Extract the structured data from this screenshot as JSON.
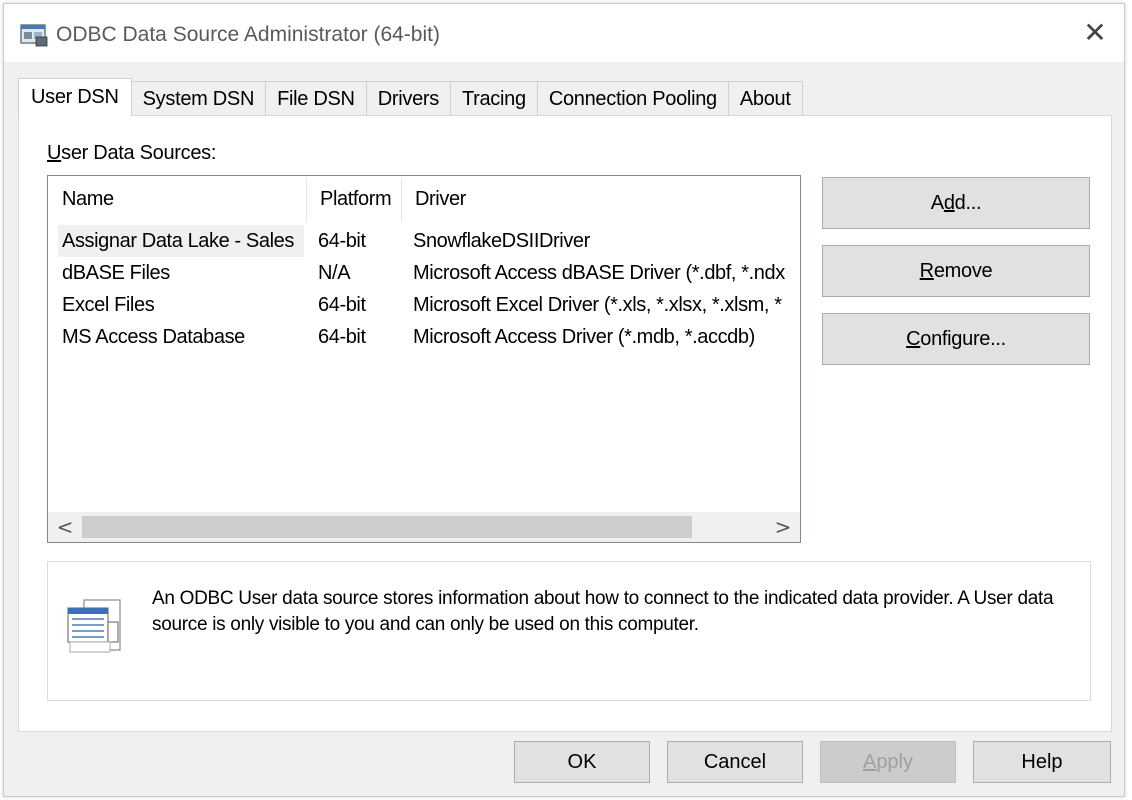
{
  "window": {
    "title": "ODBC Data Source Administrator (64-bit)",
    "close_glyph": "✕"
  },
  "tabs": [
    {
      "label": "User DSN",
      "active": true
    },
    {
      "label": "System DSN",
      "active": false
    },
    {
      "label": "File DSN",
      "active": false
    },
    {
      "label": "Drivers",
      "active": false
    },
    {
      "label": "Tracing",
      "active": false
    },
    {
      "label": "Connection Pooling",
      "active": false
    },
    {
      "label": "About",
      "active": false
    }
  ],
  "user_dsn": {
    "section_label": {
      "mnemonic": "U",
      "rest": "ser Data Sources:"
    },
    "columns": {
      "name": "Name",
      "platform": "Platform",
      "driver": "Driver"
    },
    "rows": [
      {
        "name": "Assignar Data Lake - Sales",
        "platform": "64-bit",
        "driver": "SnowflakeDSIIDriver",
        "selected": true
      },
      {
        "name": "dBASE Files",
        "platform": "N/A",
        "driver": "Microsoft Access dBASE Driver (*.dbf, *.ndx",
        "selected": false
      },
      {
        "name": "Excel Files",
        "platform": "64-bit",
        "driver": "Microsoft Excel Driver (*.xls, *.xlsx, *.xlsm, *",
        "selected": false
      },
      {
        "name": "MS Access Database",
        "platform": "64-bit",
        "driver": "Microsoft Access Driver (*.mdb, *.accdb)",
        "selected": false
      }
    ],
    "scroll_left": "<",
    "scroll_right": ">",
    "buttons": {
      "add": {
        "pre": "A",
        "mnemonic": "d",
        "post": "d..."
      },
      "remove": {
        "pre": "",
        "mnemonic": "R",
        "post": "emove"
      },
      "configure": {
        "pre": "",
        "mnemonic": "C",
        "post": "onfigure..."
      }
    },
    "info_text": "An ODBC User data source stores information about how to connect to the indicated data provider.   A User data source is only visible to you and can only be used on this computer."
  },
  "footer": {
    "ok": "OK",
    "cancel": "Cancel",
    "apply": {
      "mnemonic": "A",
      "rest": "pply",
      "disabled": true
    },
    "help": "Help"
  },
  "colors": {
    "window_bg": "#f0f0f0",
    "button_bg": "#e1e1e1",
    "disabled_text": "#a0a0a0",
    "selection_bg": "#f0f0f0"
  }
}
